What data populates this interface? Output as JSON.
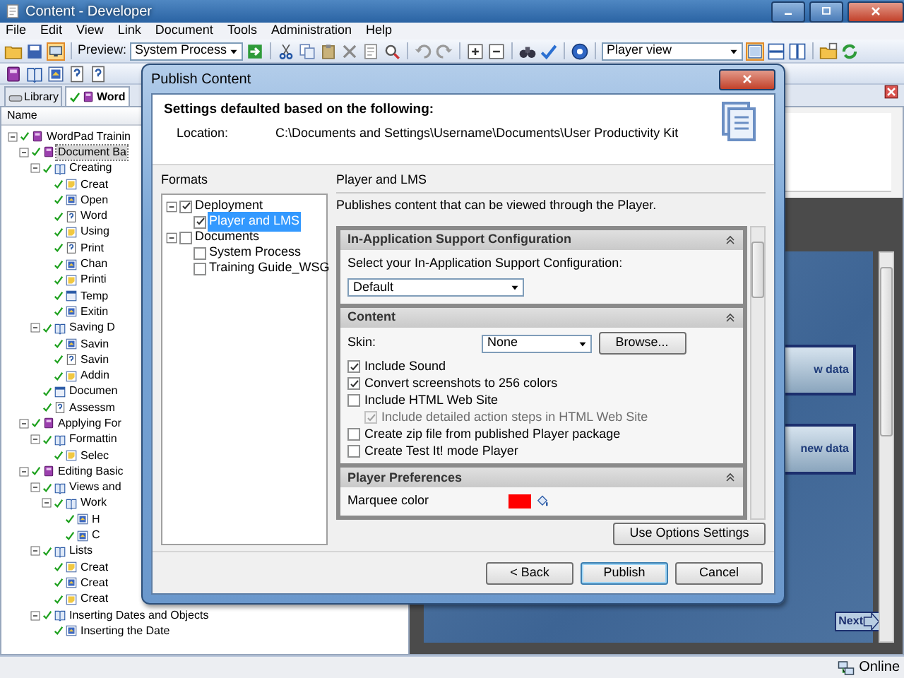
{
  "window": {
    "title": "Content - Developer"
  },
  "menu": [
    "File",
    "Edit",
    "View",
    "Link",
    "Document",
    "Tools",
    "Administration",
    "Help"
  ],
  "toolbar": {
    "preview_label": "Preview:",
    "preview_value": "System Process",
    "view_value": "Player view"
  },
  "tabs": [
    {
      "label": "Library",
      "selected": false
    },
    {
      "label": "Word",
      "selected": true
    }
  ],
  "tree": {
    "column": "Name",
    "items": [
      {
        "label": "WordPad Trainin",
        "kind": "module",
        "checked": true,
        "selected": false,
        "expanded": true,
        "children": [
          {
            "label": "Document Ba",
            "kind": "module",
            "checked": true,
            "selected": true,
            "expanded": true,
            "children": [
              {
                "label": "Creating",
                "kind": "section",
                "checked": true,
                "selected": false,
                "expanded": true,
                "children": [
                  {
                    "label": "Creat",
                    "kind": "topic",
                    "checked": true,
                    "selected": false
                  },
                  {
                    "label": "Open",
                    "kind": "topic_blue",
                    "checked": true,
                    "selected": false
                  },
                  {
                    "label": "Word",
                    "kind": "question",
                    "checked": true,
                    "selected": false
                  },
                  {
                    "label": "Using",
                    "kind": "topic",
                    "checked": true,
                    "selected": false
                  },
                  {
                    "label": "Print",
                    "kind": "question",
                    "checked": true,
                    "selected": false
                  },
                  {
                    "label": "Chan",
                    "kind": "topic_blue",
                    "checked": true,
                    "selected": false
                  },
                  {
                    "label": "Printi",
                    "kind": "topic",
                    "checked": true,
                    "selected": false
                  },
                  {
                    "label": "Temp",
                    "kind": "web_page",
                    "checked": true,
                    "selected": false
                  },
                  {
                    "label": "Exitin",
                    "kind": "topic_blue",
                    "checked": true,
                    "selected": false
                  }
                ]
              },
              {
                "label": "Saving D",
                "kind": "section",
                "checked": true,
                "selected": false,
                "expanded": true,
                "children": [
                  {
                    "label": "Savin",
                    "kind": "topic_blue",
                    "checked": true,
                    "selected": false
                  },
                  {
                    "label": "Savin",
                    "kind": "question",
                    "checked": true,
                    "selected": false
                  },
                  {
                    "label": "Addin",
                    "kind": "topic",
                    "checked": true,
                    "selected": false
                  }
                ]
              },
              {
                "label": "Documen",
                "kind": "web_page",
                "checked": true,
                "selected": false
              },
              {
                "label": "Assessm",
                "kind": "question",
                "checked": true,
                "selected": false
              }
            ]
          },
          {
            "label": "Applying For",
            "kind": "module",
            "checked": true,
            "selected": false,
            "expanded": true,
            "children": [
              {
                "label": "Formattin",
                "kind": "section",
                "checked": true,
                "selected": false,
                "expanded": true,
                "children": [
                  {
                    "label": "Selec",
                    "kind": "topic",
                    "checked": true,
                    "selected": false
                  }
                ]
              }
            ]
          },
          {
            "label": "Editing Basic",
            "kind": "module",
            "checked": true,
            "selected": false,
            "expanded": true,
            "children": [
              {
                "label": "Views and",
                "kind": "section",
                "checked": true,
                "selected": false,
                "expanded": true,
                "children": [
                  {
                    "label": "Work",
                    "kind": "section",
                    "checked": true,
                    "selected": false,
                    "expanded": true,
                    "children": [
                      {
                        "label": "H",
                        "kind": "topic_blue",
                        "checked": true,
                        "selected": false
                      },
                      {
                        "label": "C",
                        "kind": "topic_blue",
                        "checked": true,
                        "selected": false
                      }
                    ]
                  }
                ]
              },
              {
                "label": "Lists",
                "kind": "section",
                "checked": true,
                "selected": false,
                "expanded": true,
                "children": [
                  {
                    "label": "Creat",
                    "kind": "topic",
                    "checked": true,
                    "selected": false
                  },
                  {
                    "label": "Creat",
                    "kind": "topic_blue",
                    "checked": true,
                    "selected": false
                  },
                  {
                    "label": "Creat",
                    "kind": "topic",
                    "checked": true,
                    "selected": false
                  }
                ]
              },
              {
                "label": "Inserting Dates and Objects",
                "kind": "section",
                "checked": true,
                "selected": false,
                "expanded": true,
                "children": [
                  {
                    "label": "Inserting the Date",
                    "kind": "topic_blue",
                    "checked": true,
                    "selected": false
                  }
                ]
              }
            ]
          }
        ]
      }
    ]
  },
  "preview": {
    "steps": [
      "w data",
      "new data"
    ],
    "next": "Next"
  },
  "status_bar": {
    "status": "Online"
  },
  "dialog": {
    "title": "Publish Content",
    "heading": "Settings defaulted based on the following:",
    "location_label": "Location:",
    "location": "C:\\Documents and Settings\\Username\\Documents\\User Productivity Kit",
    "formats_label": "Formats",
    "formats": [
      {
        "label": "Deployment",
        "checked": true,
        "selected": false,
        "expanded": true,
        "children": [
          {
            "label": "Player and LMS",
            "checked": true,
            "selected": true
          }
        ]
      },
      {
        "label": "Documents",
        "checked": false,
        "selected": false,
        "expanded": true,
        "children": [
          {
            "label": "System Process",
            "checked": false,
            "selected": false
          },
          {
            "label": "Training Guide_WSG",
            "checked": false,
            "selected": false
          }
        ]
      }
    ],
    "detail_title": "Player and LMS",
    "description": "Publishes content that can be viewed through the Player.",
    "sections": [
      {
        "title": "In-Application Support Configuration",
        "expanded": true,
        "rows": [
          {
            "kind": "label",
            "text": "Select your In-Application Support Configuration:"
          },
          {
            "kind": "select",
            "value": "Default"
          }
        ]
      },
      {
        "title": "Content",
        "expanded": true,
        "rows": [
          {
            "kind": "skin",
            "label": "Skin:",
            "value": "None",
            "button": "Browse..."
          },
          {
            "kind": "checkbox",
            "label": "Include Sound",
            "checked": true,
            "disabled": false
          },
          {
            "kind": "checkbox",
            "label": "Convert screenshots to 256 colors",
            "checked": true,
            "disabled": false
          },
          {
            "kind": "checkbox",
            "label": "Include HTML Web Site",
            "checked": false,
            "disabled": false,
            "children": [
              {
                "kind": "checkbox",
                "label": "Include detailed action steps in HTML Web Site",
                "checked": true,
                "disabled": true
              }
            ]
          },
          {
            "kind": "checkbox",
            "label": "Create zip file from published Player package",
            "checked": false,
            "disabled": false
          },
          {
            "kind": "checkbox",
            "label": "Create Test It! mode Player",
            "checked": false,
            "disabled": false
          }
        ]
      },
      {
        "title": "Player Preferences",
        "expanded": true,
        "rows": [
          {
            "kind": "color",
            "label": "Marquee color",
            "color": "#ff0000"
          }
        ]
      }
    ],
    "options_button": "Use Options Settings",
    "buttons": [
      {
        "label": "< Back",
        "default": false
      },
      {
        "label": "Publish",
        "default": true
      },
      {
        "label": "Cancel",
        "default": false
      }
    ]
  }
}
